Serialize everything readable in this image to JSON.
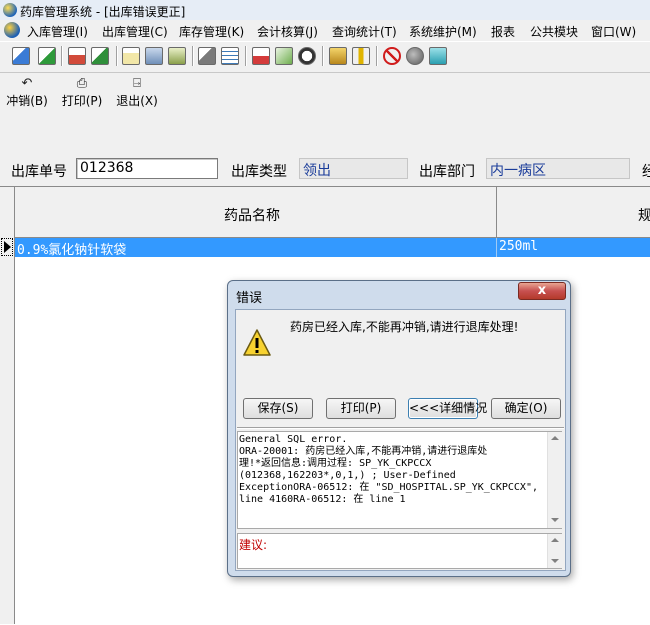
{
  "window": {
    "title": "药库管理系统 - [出库错误更正]"
  },
  "menu": [
    "入库管理(I)",
    "出库管理(C)",
    "库存管理(K)",
    "会计核算(J)",
    "查询统计(T)",
    "系统维护(M)",
    "报表",
    "公共模块",
    "窗口(W)"
  ],
  "actions": {
    "revoke": "冲销(B)",
    "print": "打印(P)",
    "exit": "退出(X)"
  },
  "form": {
    "order_label": "出库单号",
    "order_value": "012368",
    "type_label": "出库类型",
    "type_value": "领出",
    "dept_label": "出库部门",
    "dept_value": "内一病区",
    "extra_label": "经"
  },
  "grid": {
    "columns": [
      "药品名称",
      "规"
    ],
    "rows": [
      {
        "name": "0.9%氯化钠针软袋",
        "spec": "250ml"
      }
    ]
  },
  "dialog": {
    "title": "错误",
    "close": "x",
    "message": "药房已经入库,不能再冲销,请进行退库处理!",
    "buttons": {
      "save": "保存(S)",
      "print": "打印(P)",
      "details": "<<<详细情况",
      "ok": "确定(O)"
    },
    "details": "General SQL error.\nORA-20001: 药房已经入库,不能再冲销,请进行退库处\n理!*返回信息:调用过程: SP_YK_CKPCCX\n(012368,162203*,0,1,) ; User-Defined\nExceptionORA-06512: 在 \"SD_HOSPITAL.SP_YK_CKPCCX\",\nline 4160RA-06512: 在 line 1",
    "suggest_label": "建议:"
  }
}
